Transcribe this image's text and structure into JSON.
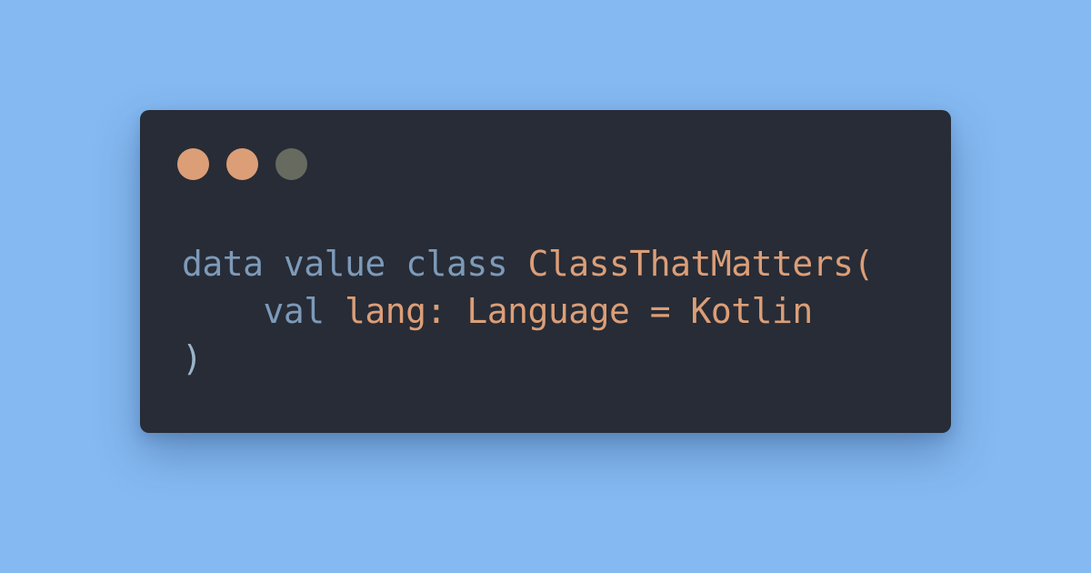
{
  "colors": {
    "background": "#85b9f1",
    "window": "#272c36",
    "dot_1": "#dc9e77",
    "dot_2": "#dc9e77",
    "dot_3": "#676a5f",
    "keyword": "#7d9ab9",
    "identifier": "#dc9e77",
    "punctuation": "#9cb3c8"
  },
  "window": {
    "controls": [
      {
        "name": "close-dot"
      },
      {
        "name": "minimize-dot"
      },
      {
        "name": "maximize-dot"
      }
    ]
  },
  "code": {
    "line_1": {
      "kw_data": "data",
      "kw_value": "value",
      "kw_class": "class",
      "class_name": "ClassThatMatters",
      "open_paren": "("
    },
    "line_2": {
      "indent": "    ",
      "kw_val": "val",
      "param_name": "lang:",
      "type_name": "Language",
      "equals": "=",
      "default_value": "Kotlin"
    },
    "line_3": {
      "close_paren": ")"
    }
  }
}
